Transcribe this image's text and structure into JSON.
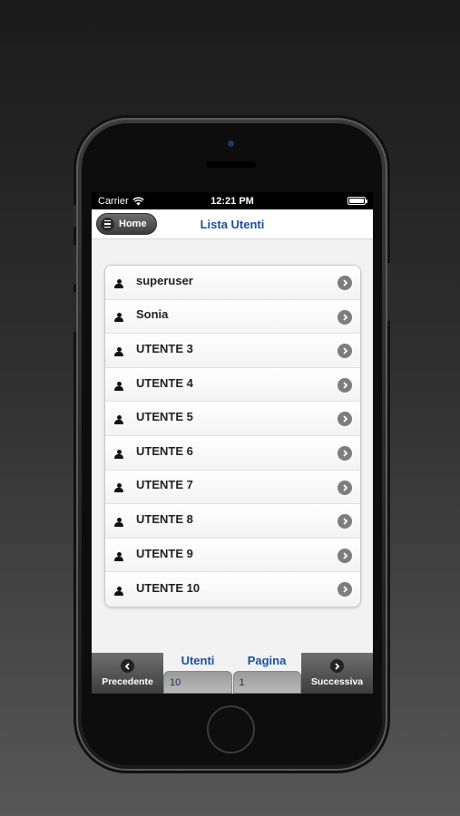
{
  "status_bar": {
    "carrier": "Carrier",
    "time": "12:21 PM"
  },
  "header": {
    "home_label": "Home",
    "title": "Lista Utenti"
  },
  "users": [
    "superuser",
    "Sonia",
    "UTENTE 3",
    "UTENTE 4",
    "UTENTE 5",
    "UTENTE 6",
    "UTENTE 7",
    "UTENTE 8",
    "UTENTE 9",
    "UTENTE 10"
  ],
  "footer": {
    "prev_label": "Precedente",
    "next_label": "Successiva",
    "users_label": "Utenti",
    "users_value": "10",
    "page_label": "Pagina",
    "page_value": "1"
  },
  "colors": {
    "accent": "#1c4f9c",
    "footer_bg": "#4a4a4a"
  },
  "icons": [
    "menu-icon",
    "wifi-icon",
    "battery-icon",
    "user-icon",
    "chevron-right-icon",
    "chevron-left-icon"
  ]
}
